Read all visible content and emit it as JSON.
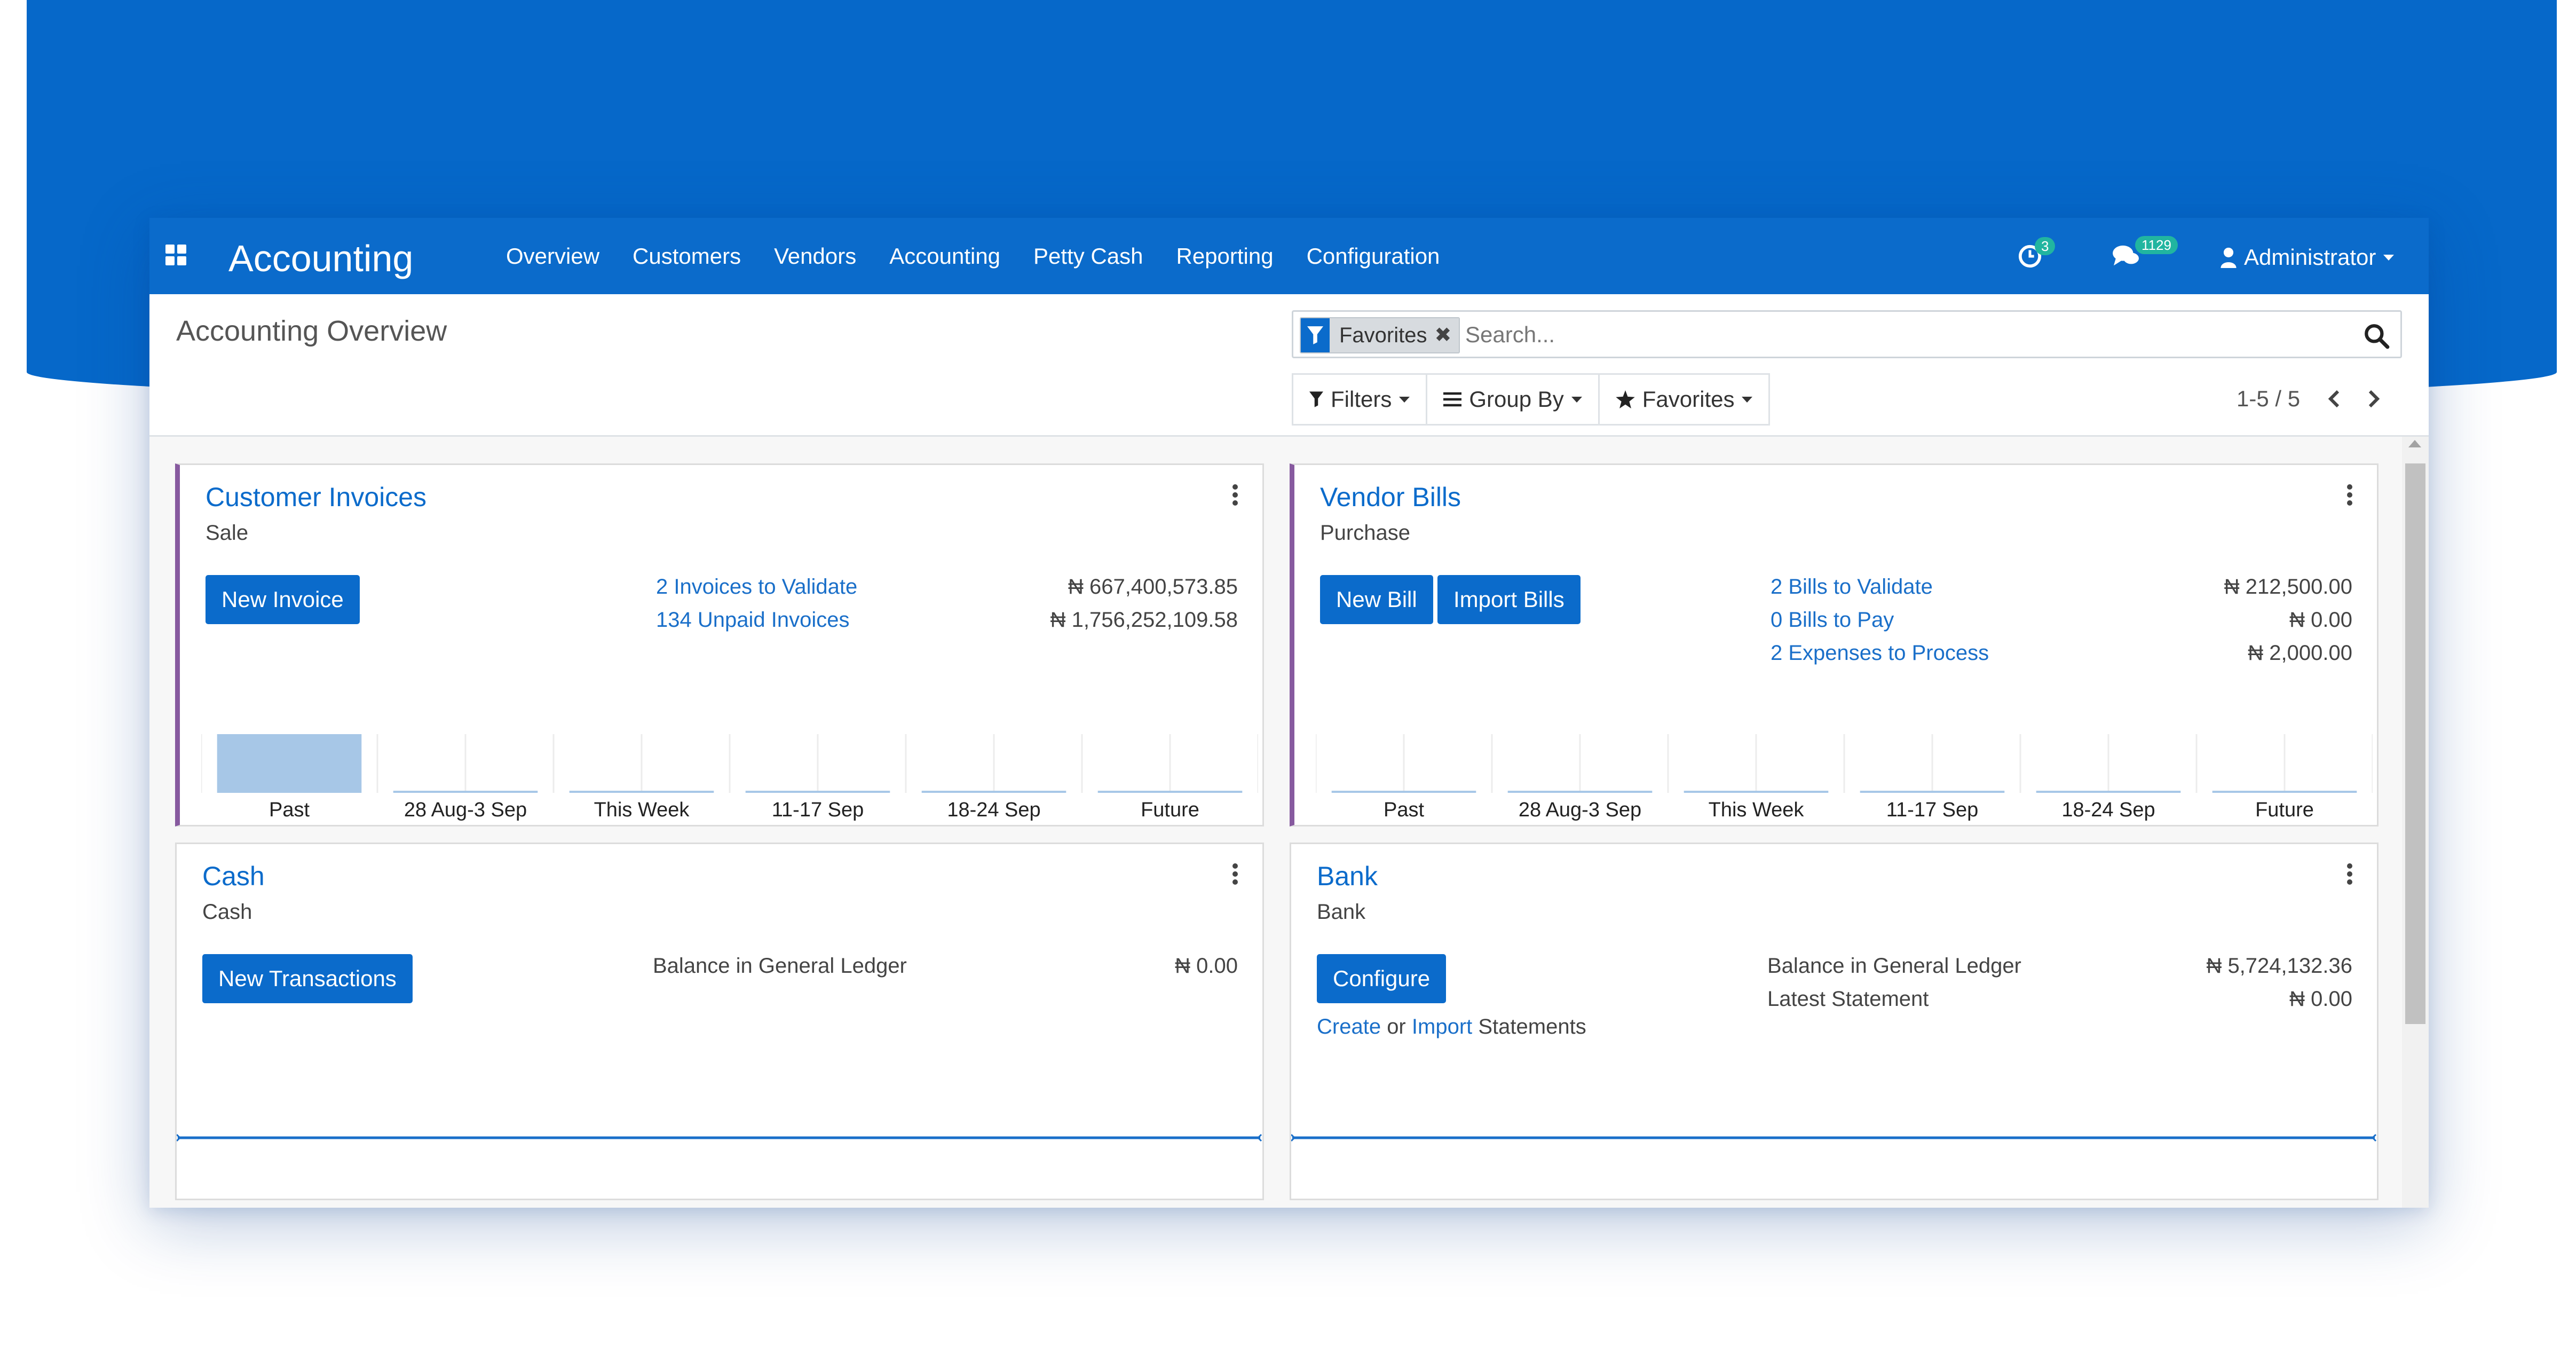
{
  "navbar": {
    "app_title": "Accounting",
    "menu": [
      "Overview",
      "Customers",
      "Vendors",
      "Accounting",
      "Petty Cash",
      "Reporting",
      "Configuration"
    ],
    "activity_count": "3",
    "messages_count": "1129",
    "user": "Administrator"
  },
  "control": {
    "page_title": "Accounting Overview",
    "facet_label": "Favorites",
    "search_placeholder": "Search...",
    "filters_label": "Filters",
    "groupby_label": "Group By",
    "favorites_label": "Favorites",
    "pager": "1-5 / 5"
  },
  "cards": {
    "customer_invoices": {
      "title": "Customer Invoices",
      "type": "Sale",
      "button": "New Invoice",
      "links": [
        "2 Invoices to Validate",
        "134 Unpaid Invoices"
      ],
      "amounts": [
        "₦ 667,400,573.85",
        "₦ 1,756,252,109.58"
      ],
      "chart": {
        "categories": [
          "Past",
          "28 Aug-3 Sep",
          "This Week",
          "11-17 Sep",
          "18-24 Sep",
          "Future"
        ],
        "values": [
          1,
          0,
          0,
          0,
          0,
          0
        ]
      }
    },
    "vendor_bills": {
      "title": "Vendor Bills",
      "type": "Purchase",
      "button": "New Bill",
      "button2": "Import Bills",
      "links": [
        "2 Bills to Validate",
        "0 Bills to Pay",
        "2 Expenses to Process"
      ],
      "amounts": [
        "₦ 212,500.00",
        "₦ 0.00",
        "₦ 2,000.00"
      ],
      "chart": {
        "categories": [
          "Past",
          "28 Aug-3 Sep",
          "This Week",
          "11-17 Sep",
          "18-24 Sep",
          "Future"
        ],
        "values": [
          0,
          0,
          0,
          0,
          0,
          0
        ]
      }
    },
    "cash": {
      "title": "Cash",
      "type": "Cash",
      "button": "New Transactions",
      "label": "Balance in General Ledger",
      "amount": "₦ 0.00"
    },
    "bank": {
      "title": "Bank",
      "type": "Bank",
      "button": "Configure",
      "create": "Create",
      "or": "or",
      "import": "Import",
      "statements": "Statements",
      "label1": "Balance in General Ledger",
      "label2": "Latest Statement",
      "amount1": "₦ 5,724,132.36",
      "amount2": "₦ 0.00"
    }
  },
  "colors": {
    "brand": "#0b6bcb",
    "accent_purple": "#875a9f",
    "bar": "#a7c7e7"
  }
}
